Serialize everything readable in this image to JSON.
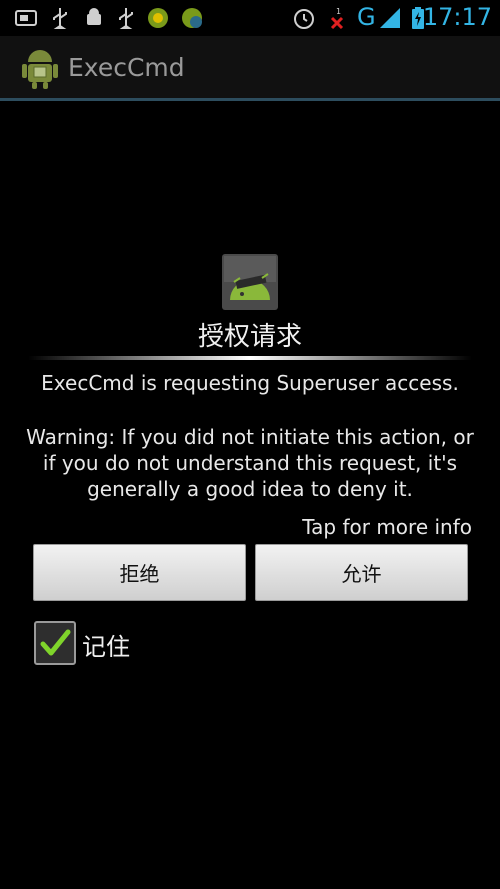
{
  "status_bar": {
    "time": "17:17",
    "network": "G",
    "icons": [
      "sim-card-icon",
      "usb-icon",
      "android-debug-icon",
      "usb-icon",
      "app-notification-icon",
      "sync-notification-icon",
      "alarm-icon",
      "no-signal-icon",
      "signal-icon",
      "battery-charging-icon"
    ]
  },
  "app": {
    "title": "ExecCmd",
    "icon": "android-icon"
  },
  "dialog": {
    "icon": "superuser-icon",
    "title": "授权请求",
    "request": "ExecCmd is requesting Superuser access.",
    "warning": "Warning: If you did not initiate this action, or if you do not understand this request, it's generally a good idea to deny it.",
    "more_info": "Tap for more info",
    "deny_label": "拒绝",
    "allow_label": "允许",
    "remember_label": "记住",
    "remember_checked": true
  },
  "colors": {
    "accent": "#33b5e5",
    "check": "#7fd42b",
    "background": "#000000"
  }
}
